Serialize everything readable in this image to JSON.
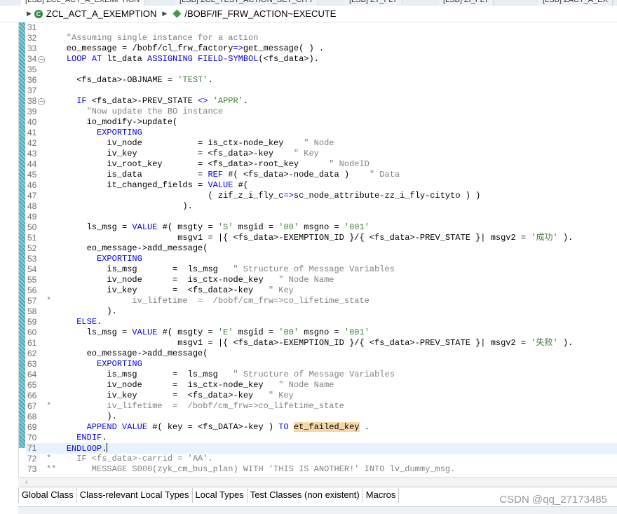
{
  "tabs": [
    {
      "label": "[LSB] ZCL_ACT_A_EXEMPTION"
    },
    {
      "label": "[LSB] ZCL_TEST_ACTION_SET_CITY"
    },
    {
      "label": "[LSB] ZT_FLY"
    },
    {
      "label": "[LSB] ZI_FLY"
    },
    {
      "label": "[LSB] ZACT_A_EX"
    }
  ],
  "breadcrumb": {
    "class_name": "ZCL_ACT_A_EXEMPTION",
    "method_name": "/BOBF/IF_FRW_ACTION~EXECUTE"
  },
  "bottom_tabs": [
    {
      "label": "Global Class",
      "accel": "G"
    },
    {
      "label": "Class-relevant Local Types",
      "accel": "C"
    },
    {
      "label": "Local Types",
      "accel": "L"
    },
    {
      "label": "Test Classes (non existent)",
      "accel": "T"
    },
    {
      "label": "Macros",
      "accel": "M"
    }
  ],
  "watermark": "CSDN @qq_27173485",
  "code": {
    "lines": [
      {
        "n": "31",
        "text": ""
      },
      {
        "n": "32",
        "text": "    \"Assuming single instance for a action"
      },
      {
        "n": "33",
        "text": "    eo_message = /bobf/cl_frw_factory=>get_message( ) ."
      },
      {
        "n": "34",
        "text": "    LOOP AT lt_data ASSIGNING FIELD-SYMBOL(<fs_data>).",
        "fold": true
      },
      {
        "n": "35",
        "text": ""
      },
      {
        "n": "36",
        "text": "      <fs_data>-OBJNAME = 'TEST'."
      },
      {
        "n": "37",
        "text": ""
      },
      {
        "n": "38",
        "text": "      IF <fs_data>-PREV_STATE <> 'APPR'.",
        "fold": true
      },
      {
        "n": "39",
        "text": "        \"Now update the BO instance"
      },
      {
        "n": "40",
        "text": "        io_modify->update("
      },
      {
        "n": "41",
        "text": "          EXPORTING"
      },
      {
        "n": "42",
        "text": "            iv_node           = is_ctx-node_key    \" Node"
      },
      {
        "n": "43",
        "text": "            iv_key            = <fs_data>-key    \" Key"
      },
      {
        "n": "44",
        "text": "            iv_root_key       = <fs_data>-root_key      \" NodeID"
      },
      {
        "n": "45",
        "text": "            is_data           = REF #( <fs_data>-node_data )    \" Data"
      },
      {
        "n": "46",
        "text": "            it_changed_fields = VALUE #("
      },
      {
        "n": "47",
        "text": "                                ( zif_z_i_fly_c=>sc_node_attribute-zz_i_fly-cityto ) )"
      },
      {
        "n": "48",
        "text": "                           )."
      },
      {
        "n": "49",
        "text": ""
      },
      {
        "n": "50",
        "text": "        ls_msg = VALUE #( msgty = 'S' msgid = '00' msgno = '001'"
      },
      {
        "n": "51",
        "text": "                          msgv1 = |{ <fs_data>-EXEMPTION_ID }/{ <fs_data>-PREV_STATE }| msgv2 = '成功' )."
      },
      {
        "n": "52",
        "text": "        eo_message->add_message("
      },
      {
        "n": "53",
        "text": "          EXPORTING"
      },
      {
        "n": "54",
        "text": "            is_msg       =  ls_msg   \" Structure of Message Variables"
      },
      {
        "n": "55",
        "text": "            iv_node      =  is_ctx-node_key   \" Node Name"
      },
      {
        "n": "56",
        "text": "            iv_key       =  <fs_data>-key   \" Key"
      },
      {
        "n": "57",
        "text": "*                iv_lifetime  =  /bobf/cm_frw=>co_lifetime_state"
      },
      {
        "n": "58",
        "text": "            )."
      },
      {
        "n": "59",
        "text": "      ELSE."
      },
      {
        "n": "60",
        "text": "        ls_msg = VALUE #( msgty = 'E' msgid = '00' msgno = '001'"
      },
      {
        "n": "61",
        "text": "                          msgv1 = |{ <fs_data>-EXEMPTION_ID }/{ <fs_data>-PREV_STATE }| msgv2 = '失败' )."
      },
      {
        "n": "62",
        "text": "        eo_message->add_message("
      },
      {
        "n": "63",
        "text": "          EXPORTING"
      },
      {
        "n": "64",
        "text": "            is_msg       =  ls_msg   \" Structure of Message Variables"
      },
      {
        "n": "65",
        "text": "            iv_node      =  is_ctx-node_key   \" Node Name"
      },
      {
        "n": "66",
        "text": "            iv_key       =  <fs_data>-key   \" Key"
      },
      {
        "n": "67",
        "text": "*           iv_lifetime  =  /bobf/cm_frw=>co_lifetime_state"
      },
      {
        "n": "68",
        "text": "            )."
      },
      {
        "n": "69",
        "text": "        APPEND VALUE #( key = <fs_DATA>-key ) TO et_failed_key ."
      },
      {
        "n": "70",
        "text": "      ENDIF."
      },
      {
        "n": "71",
        "text": "    ENDLOOP.",
        "current": true
      },
      {
        "n": "72",
        "text": "*     IF <fs_data>-carrid = 'AA'."
      },
      {
        "n": "73",
        "text": "**       MESSAGE S000(zyk_cm_bus_plan) WITH 'THIS IS ANOTHER!' INTO lv_dummy_msg."
      }
    ]
  }
}
